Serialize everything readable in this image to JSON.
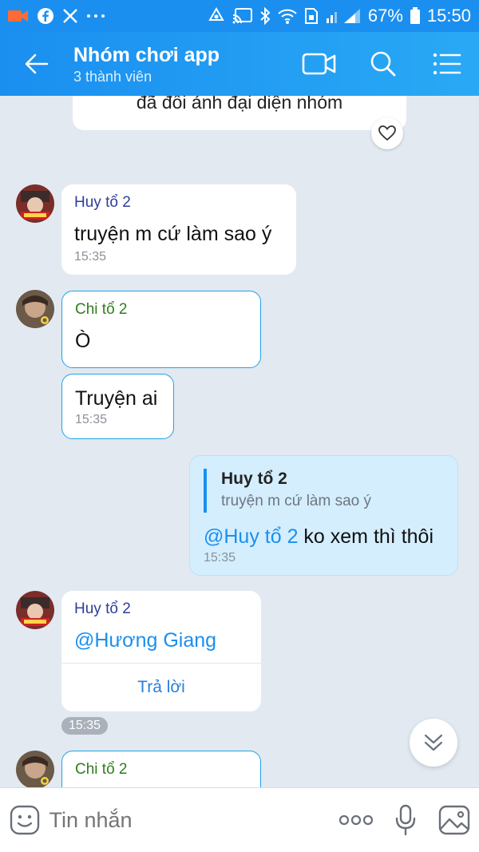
{
  "status_bar": {
    "battery": "67%",
    "time": "15:50"
  },
  "header": {
    "title": "Nhóm chơi app",
    "subtitle": "3 thành viên"
  },
  "messages": {
    "prev_notice": "đã đổi ảnh đại diện nhóm",
    "msg1": {
      "sender": "Huy tổ 2",
      "text": "truyện m cứ làm sao ý",
      "time": "15:35"
    },
    "msg2": {
      "sender": "Chi tổ 2",
      "text": "Ò"
    },
    "msg3": {
      "text": "Truyện ai",
      "time": "15:35"
    },
    "msg4": {
      "quote_sender": "Huy tổ 2",
      "quote_text": "truyện m cứ làm sao ý",
      "mention": "@Huy tổ 2",
      "text": " ko xem thì thôi",
      "time": "15:35"
    },
    "msg5": {
      "sender": "Huy tổ 2",
      "mention": "@Hương Giang",
      "reply_label": "Trả lời"
    },
    "time_chip": "15:35",
    "msg6": {
      "sender": "Chi tổ 2"
    }
  },
  "input": {
    "placeholder": "Tin nhắn"
  },
  "colors": {
    "primary": "#1a8ff0",
    "chat_bg": "#e2e9f1",
    "sent_bubble": "#d4eefe"
  }
}
